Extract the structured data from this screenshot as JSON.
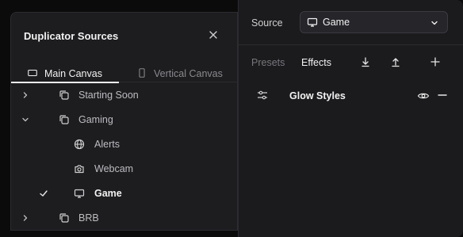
{
  "dialog": {
    "title": "Duplicator Sources",
    "close_icon": "close-icon"
  },
  "canvas_tabs": [
    {
      "label": "Main Canvas",
      "icon": "landscape-screen-icon",
      "active": true
    },
    {
      "label": "Vertical Canvas",
      "icon": "portrait-phone-icon",
      "active": false
    }
  ],
  "tree": [
    {
      "label": "Starting Soon",
      "icon": "scene-copy-icon",
      "expanded": false,
      "has_children": true
    },
    {
      "label": "Gaming",
      "icon": "scene-copy-icon",
      "expanded": true,
      "has_children": true
    },
    {
      "label": "Alerts",
      "icon": "globe-icon",
      "child": true
    },
    {
      "label": "Webcam",
      "icon": "camera-icon",
      "child": true
    },
    {
      "label": "Game",
      "icon": "monitor-icon",
      "child": true,
      "selected": true
    },
    {
      "label": "BRB",
      "icon": "scene-copy-icon",
      "expanded": false,
      "has_children": true
    }
  ],
  "source": {
    "label": "Source",
    "selected": "Game",
    "icon": "monitor-icon"
  },
  "effect_tabs": {
    "presets": "Presets",
    "effects": "Effects",
    "active": "Effects"
  },
  "toolbar": {
    "download_icon": "download-icon",
    "upload_icon": "upload-icon",
    "add_icon": "plus-icon"
  },
  "effects": [
    {
      "name": "Glow Styles",
      "icon": "sliders-icon",
      "visible": true
    }
  ],
  "colors": {
    "background": "#0b0b0c",
    "panel": "#1d1d20",
    "text": "#f2f2f2",
    "muted": "#77777c"
  }
}
